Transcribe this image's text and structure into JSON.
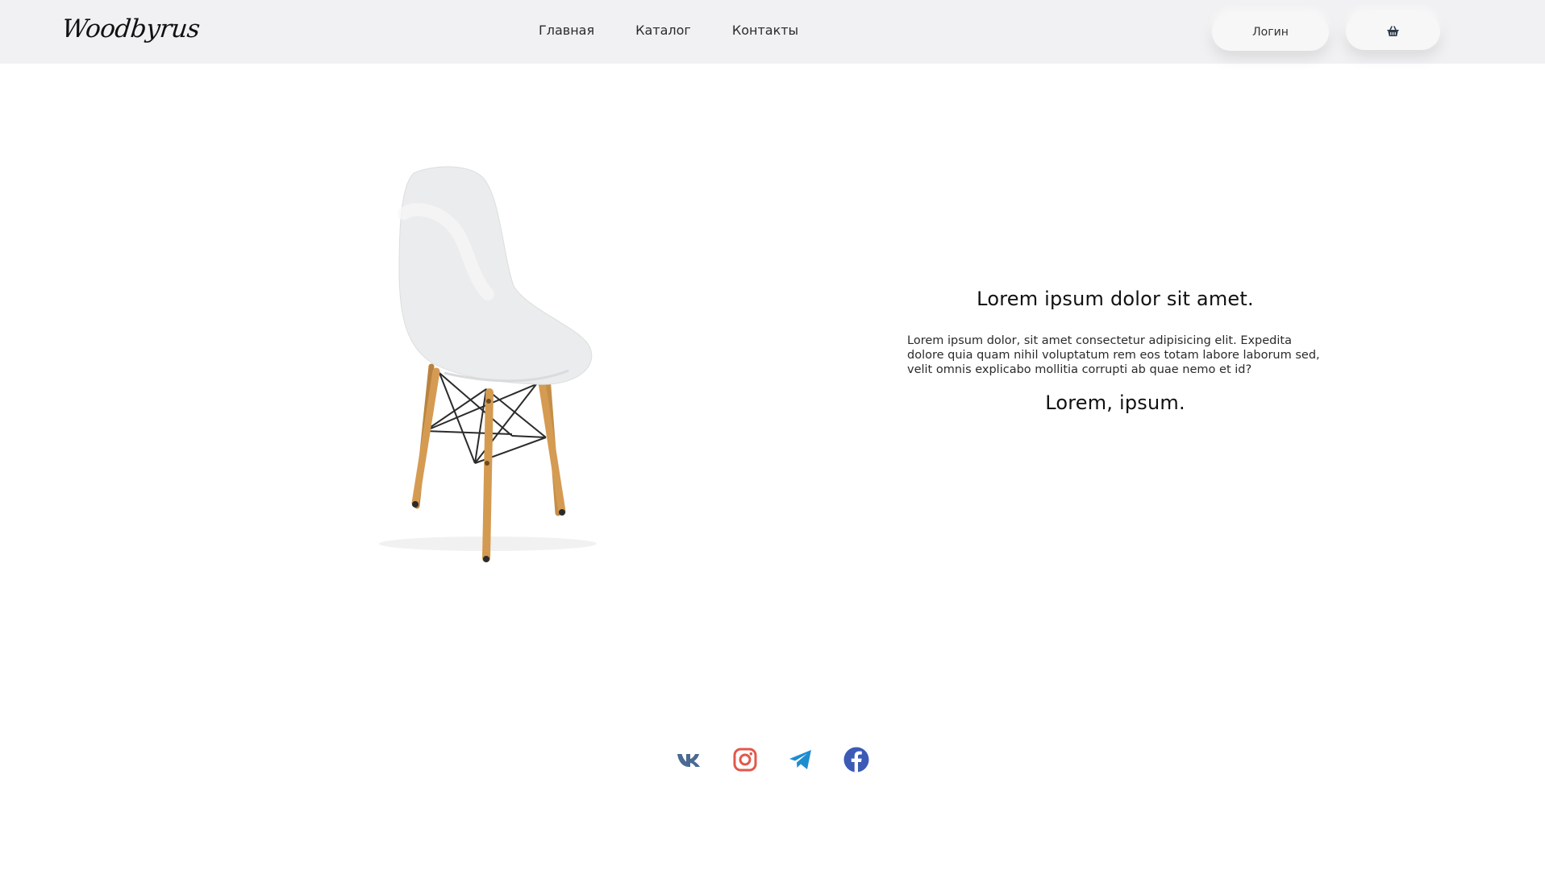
{
  "header": {
    "logo": "Woodbyrus",
    "nav": [
      "Главная",
      "Каталог",
      "Контакты"
    ],
    "login_label": "Логин",
    "cart_icon": "basket-icon"
  },
  "hero": {
    "image": "white-chair-wooden-legs",
    "title": "Lorem ipsum dolor sit amet.",
    "body": "Lorem ipsum dolor, sit amet consectetur adipisicing elit. Expedita dolore quia quam nihil voluptatum rem eos totam labore laborum sed, velit omnis explicabo mollitia corrupti ab quae nemo et id?",
    "subtitle": "Lorem, ipsum."
  },
  "social": {
    "icons": [
      "vk-icon",
      "instagram-icon",
      "telegram-icon",
      "facebook-icon"
    ],
    "colors": {
      "vk": "#4a6a93",
      "instagram": "#e2574c",
      "telegram": "#1d8dd0",
      "facebook": "#3b5bb6"
    }
  },
  "colors": {
    "header_bg": "#f1f1f3",
    "page_bg": "#ffffff",
    "text": "#111111"
  }
}
